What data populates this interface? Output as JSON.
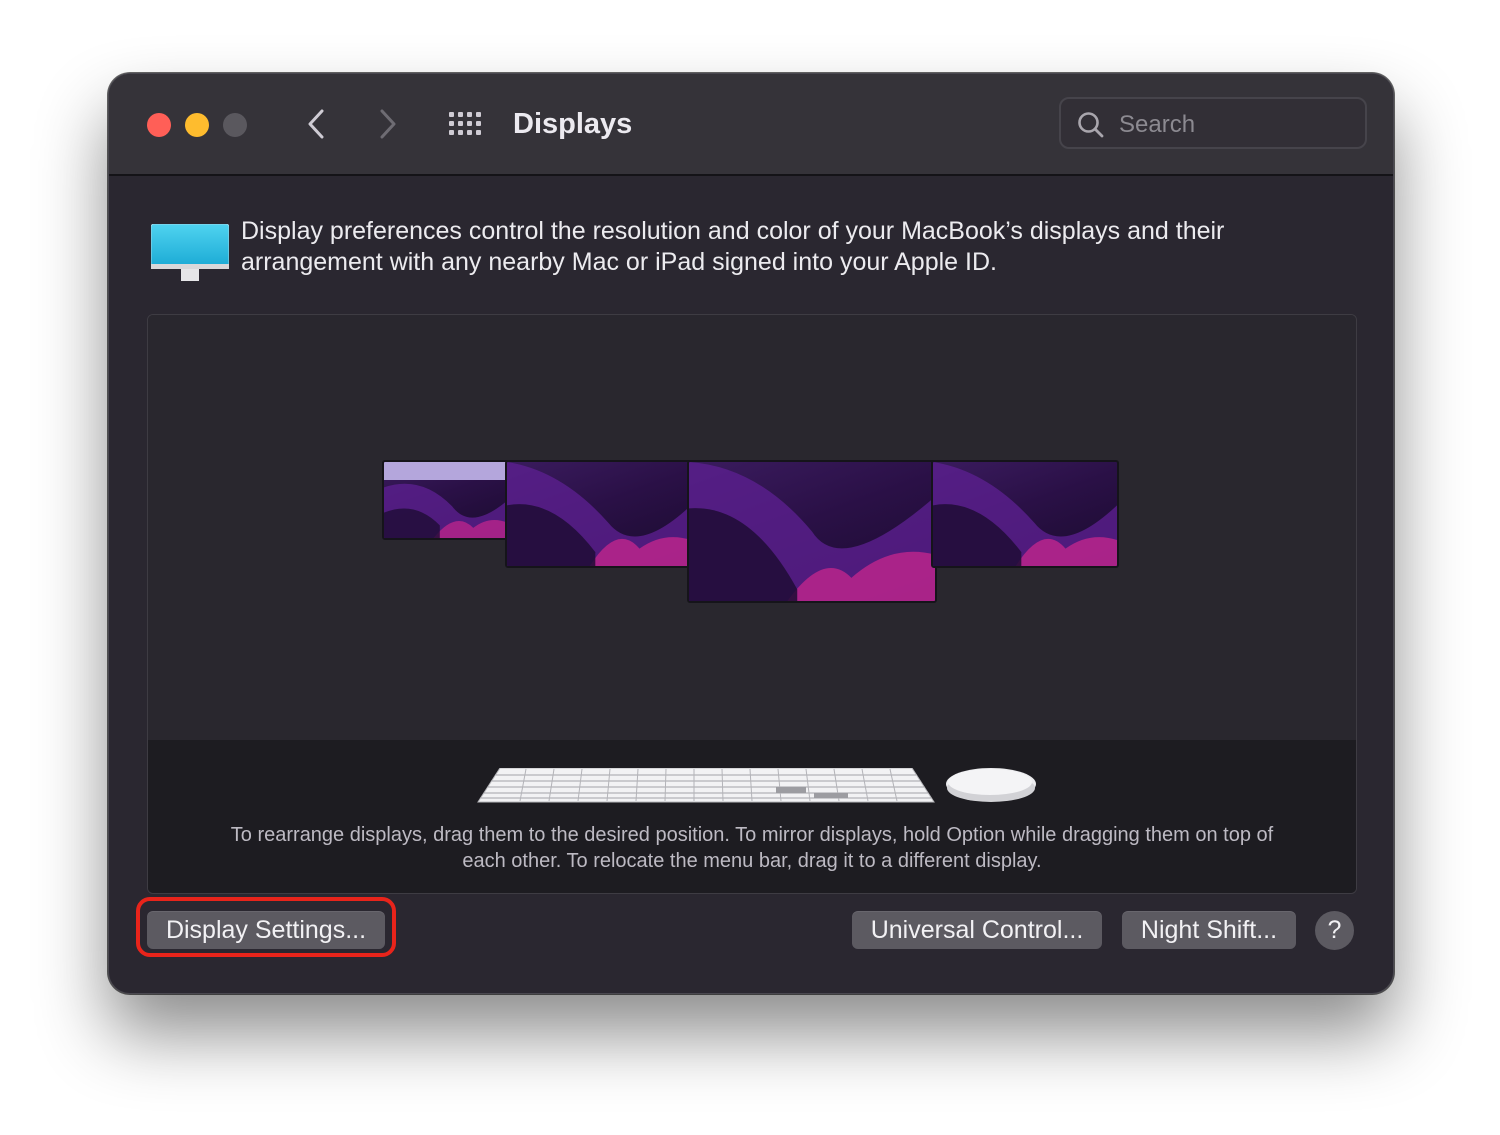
{
  "window": {
    "title": "Displays",
    "search": {
      "placeholder": "Search",
      "value": ""
    }
  },
  "intro": {
    "text": "Display preferences control the resolution and color of your MacBook’s displays and their arrangement with any nearby Mac or iPad signed into your Apple ID."
  },
  "arrangement": {
    "hint": "To rearrange displays, drag them to the desired position. To mirror displays, hold Option while dragging them on top of each other. To relocate the menu bar, drag it to a different display."
  },
  "buttons": {
    "display_settings": "Display Settings...",
    "universal_control": "Universal Control...",
    "night_shift": "Night Shift...",
    "help": "?"
  },
  "icons": {
    "close": "close-dot-icon",
    "minimize": "minimize-dot-icon",
    "zoom": "zoom-dot-icon",
    "back": "chevron-left-icon",
    "forward": "chevron-right-icon",
    "show_all": "grid-icon",
    "search": "search-icon",
    "display": "display-icon",
    "keyboard": "keyboard-icon",
    "mouse": "mouse-icon"
  },
  "colors": {
    "highlight": "#e8241b",
    "traffic_close": "#ff5f57",
    "traffic_minimize": "#febc2e",
    "traffic_zoom_inactive": "#5a585e"
  }
}
